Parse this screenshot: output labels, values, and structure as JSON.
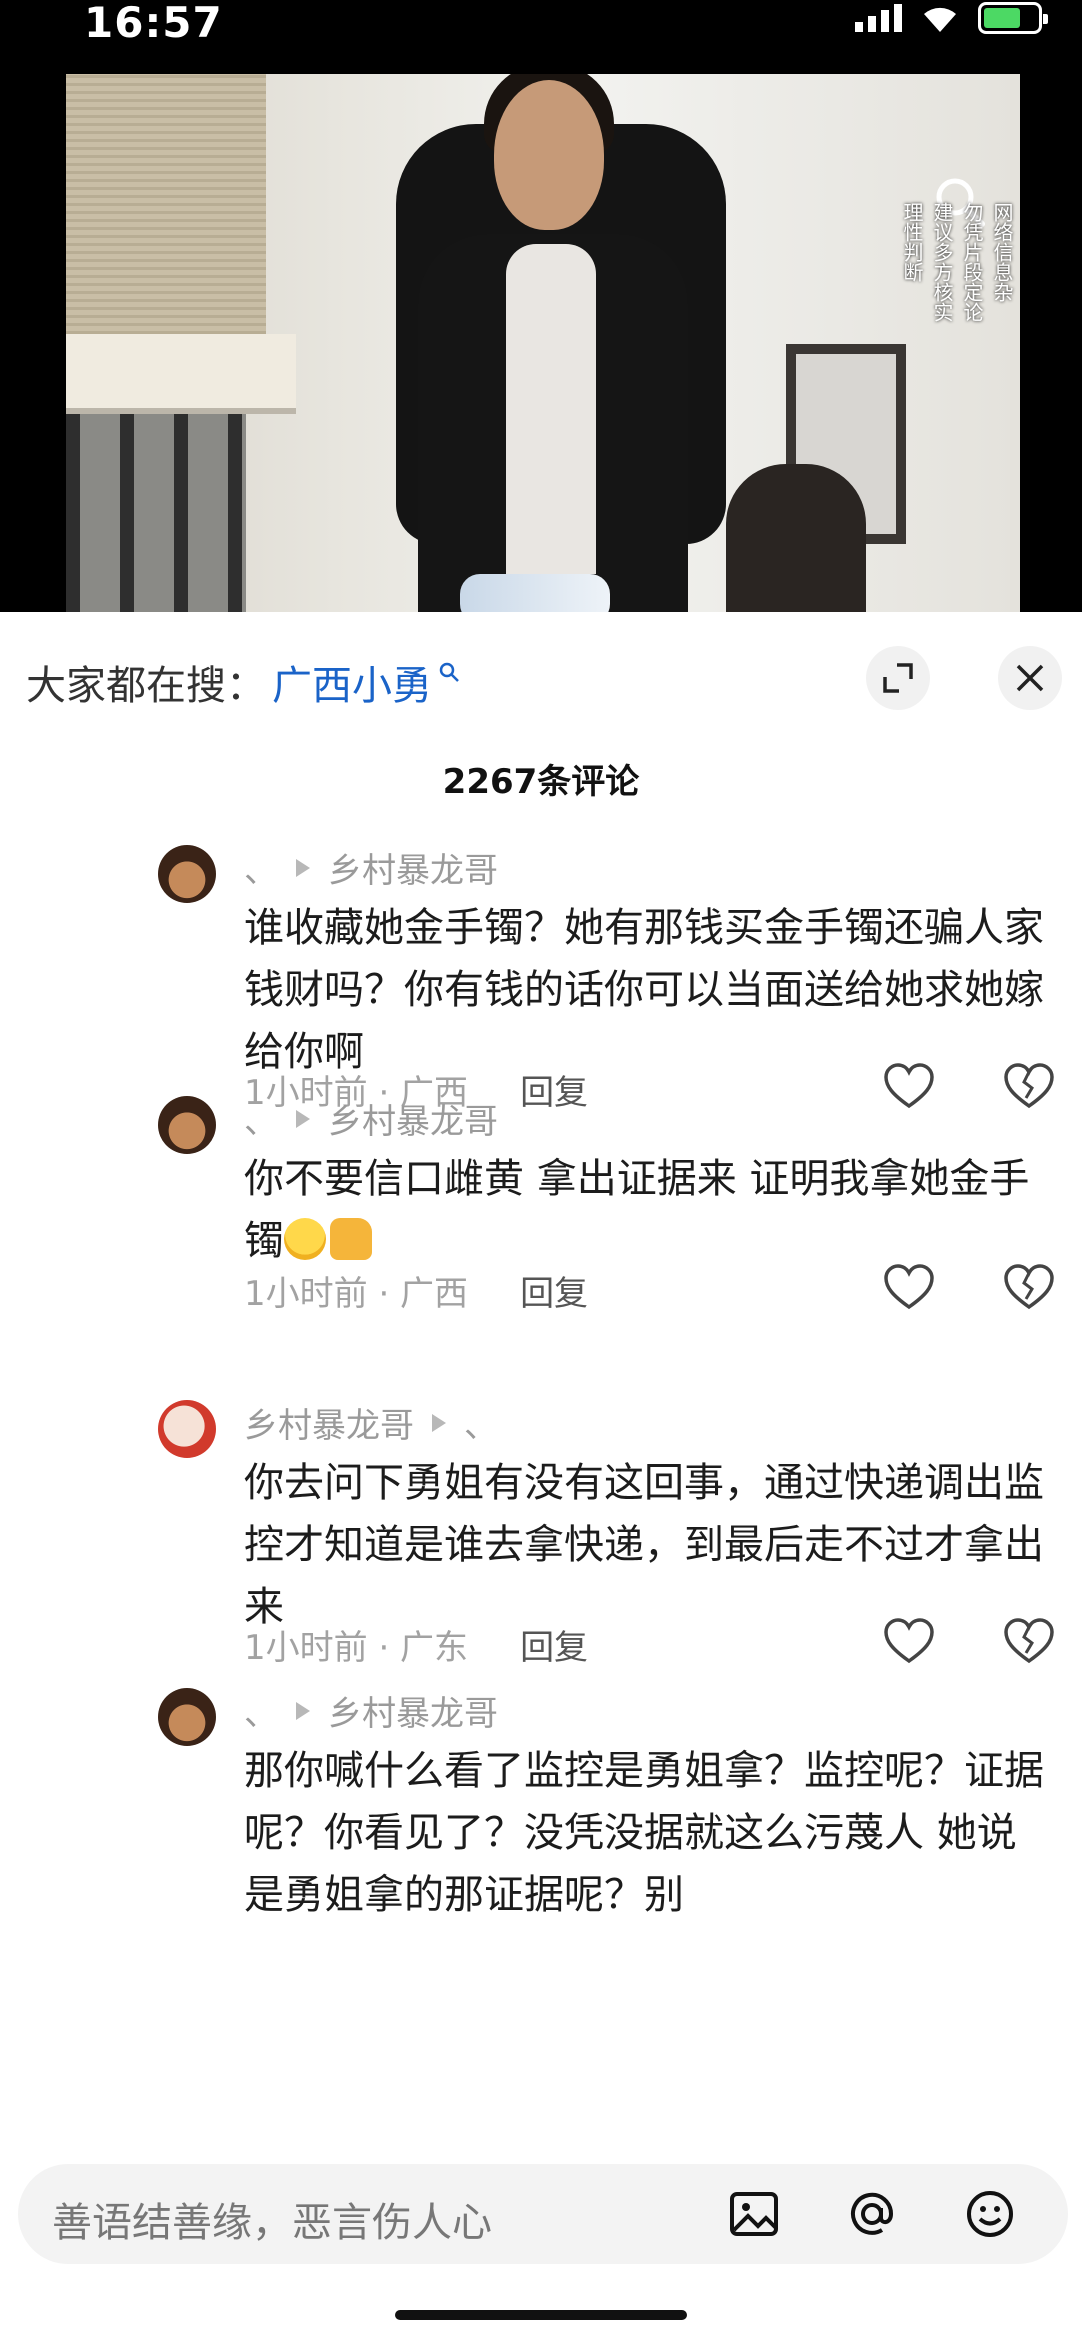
{
  "status": {
    "time": "16:57"
  },
  "video": {
    "caption_lines": [
      "网络信息杂",
      "勿凭片段定论",
      "建议多方核实",
      "理性判断"
    ]
  },
  "sheet": {
    "search_prefix": "大家都在搜：",
    "search_term": "广西小勇",
    "comment_count": "2267条评论"
  },
  "comments": [
    {
      "avatar": "cartoon-face-avatar",
      "prefix": "、",
      "arrow_after": false,
      "name": "乡村暴龙哥",
      "text": "谁收藏她金手镯？她有那钱买金手镯还骗人家钱财吗？你有钱的话你可以当面送给她求她嫁给你啊",
      "time_loc": "1小时前 · 广西",
      "reply": "回复"
    },
    {
      "avatar": "cartoon-face-avatar",
      "prefix": "、",
      "arrow_after": false,
      "name": "乡村暴龙哥",
      "text": "你不要信口雌黄 拿出证据来 证明我拿她金手镯",
      "emojis": [
        "grin-sweat-emoji",
        "thumbs-up-emoji"
      ],
      "time_loc": "1小时前 · 广西",
      "reply": "回复"
    },
    {
      "avatar": "red-character-avatar",
      "prefix": "、",
      "arrow_after": true,
      "name": "乡村暴龙哥",
      "text": "你去问下勇姐有没有这回事，通过快递调出监控才知道是谁去拿快递，到最后走不过才拿出来",
      "time_loc": "1小时前 · 广东",
      "reply": "回复"
    },
    {
      "avatar": "cartoon-face-avatar",
      "prefix": "、",
      "arrow_after": false,
      "name": "乡村暴龙哥",
      "text": "那你喊什么看了监控是勇姐拿？监控呢？证据呢？你看见了？没凭没据就这么污蔑人 她说是勇姐拿的那证据呢？别"
    }
  ],
  "input": {
    "placeholder": "善语结善缘，恶言伤人心"
  },
  "colors": {
    "link": "#1a63c8",
    "meta": "#9a9a9a",
    "battery": "#4cd964"
  }
}
